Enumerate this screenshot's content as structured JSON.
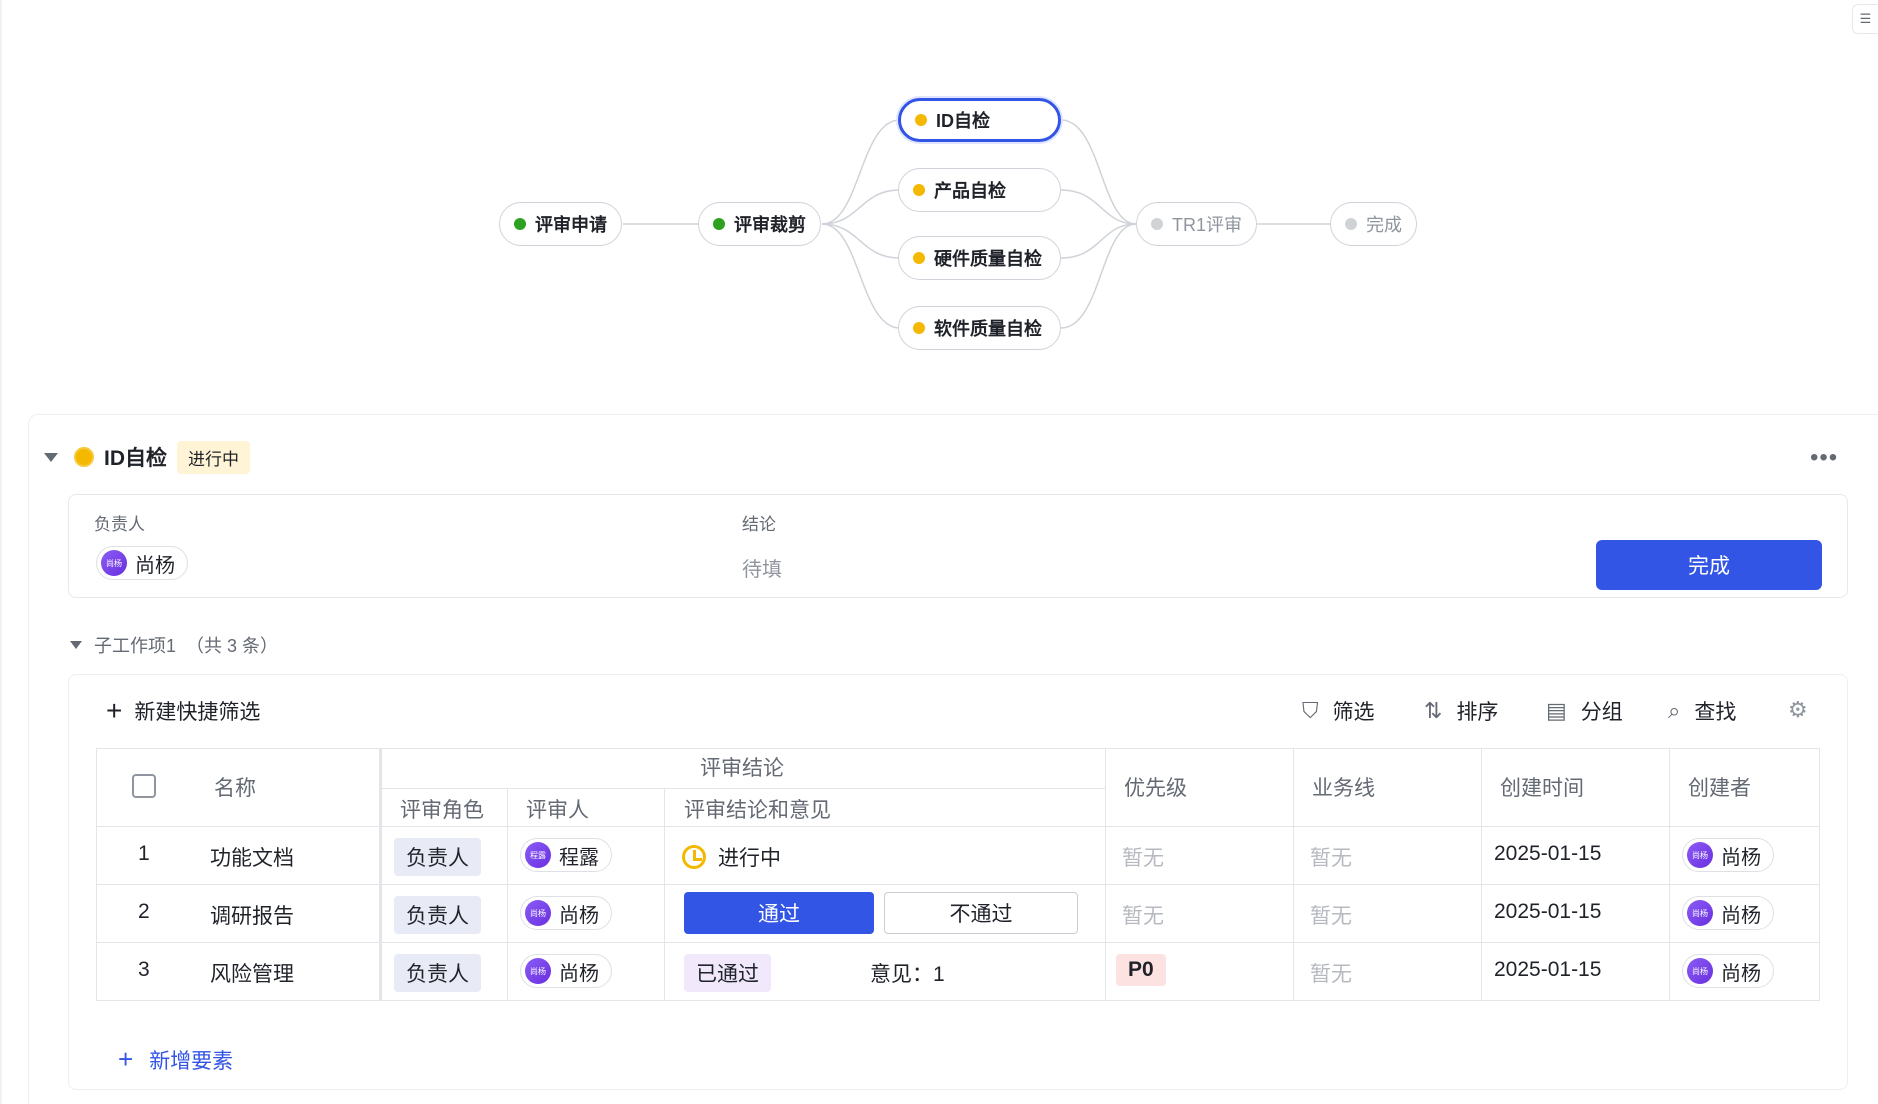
{
  "flow": {
    "nodes": [
      {
        "id": "apply",
        "label": "评审申请",
        "status": "green"
      },
      {
        "id": "trim",
        "label": "评审裁剪",
        "status": "green"
      },
      {
        "id": "id_check",
        "label": "ID自检",
        "status": "yellow",
        "active": true
      },
      {
        "id": "product_check",
        "label": "产品自检",
        "status": "yellow"
      },
      {
        "id": "hw_check",
        "label": "硬件质量自检",
        "status": "yellow"
      },
      {
        "id": "sw_check",
        "label": "软件质量自检",
        "status": "yellow"
      },
      {
        "id": "tr1",
        "label": "TR1评审",
        "status": "gray"
      },
      {
        "id": "done",
        "label": "完成",
        "status": "gray"
      }
    ]
  },
  "stage": {
    "title": "ID自检",
    "status": "进行中",
    "more": "•••"
  },
  "info": {
    "owner_label": "负责人",
    "owner_avatar": "尚杨",
    "owner_name": "尚杨",
    "conclusion_label": "结论",
    "conclusion_value": "待填",
    "complete_button": "完成"
  },
  "subitems": {
    "title": "子工作项1",
    "count": "（共 3 条）"
  },
  "toolbar": {
    "new_filter": "新建快捷筛选",
    "filter": "筛选",
    "sort": "排序",
    "group": "分组",
    "search": "查找"
  },
  "table": {
    "headers": {
      "name": "名称",
      "review_group": "评审结论",
      "role": "评审角色",
      "reviewer": "评审人",
      "conclusion": "评审结论和意见",
      "priority": "优先级",
      "business": "业务线",
      "created": "创建时间",
      "creator": "创建者"
    },
    "rows": [
      {
        "index": "1",
        "name": "功能文档",
        "role": "负责人",
        "reviewer_avatar": "程露",
        "reviewer": "程露",
        "conclusion": "进行中",
        "priority": "暂无",
        "business": "暂无",
        "created": "2025-01-15",
        "creator_avatar": "尚杨",
        "creator": "尚杨"
      },
      {
        "index": "2",
        "name": "调研报告",
        "role": "负责人",
        "reviewer_avatar": "尚杨",
        "reviewer": "尚杨",
        "pass": "通过",
        "fail": "不通过",
        "priority": "暂无",
        "business": "暂无",
        "created": "2025-01-15",
        "creator_avatar": "尚杨",
        "creator": "尚杨"
      },
      {
        "index": "3",
        "name": "风险管理",
        "role": "负责人",
        "reviewer_avatar": "尚杨",
        "reviewer": "尚杨",
        "conclusion": "已通过",
        "opinion": "意见：1",
        "priority": "P0",
        "business": "暂无",
        "created": "2025-01-15",
        "creator_avatar": "尚杨",
        "creator": "尚杨"
      }
    ]
  },
  "add_element": "新增要素",
  "colors": {
    "accent": "#3355e6",
    "in_progress": "#f5b800",
    "done": "#2ea121"
  }
}
